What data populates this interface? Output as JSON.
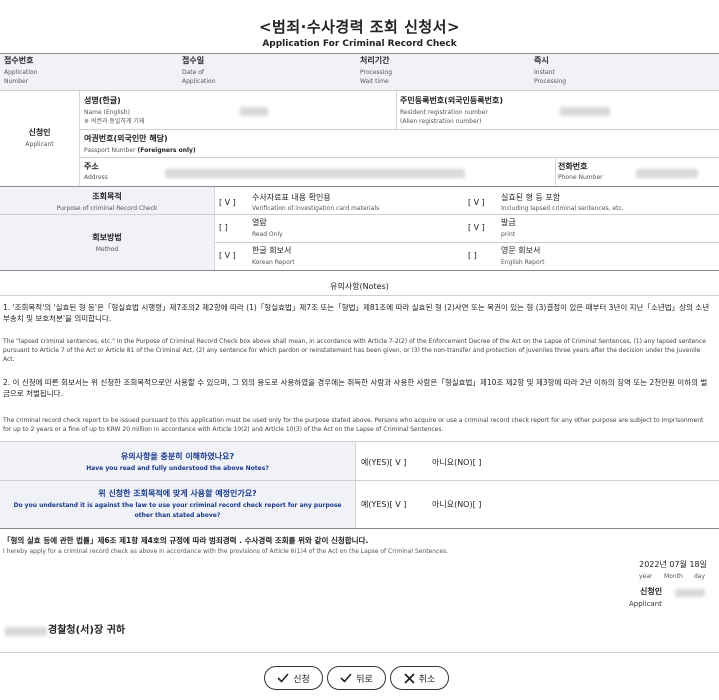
{
  "form": {
    "title": "<범죄·수사경력 조회 신청서>",
    "subtitle": "Application For Criminal Record Check"
  },
  "header_row": {
    "receipt_no_ko": "접수번호",
    "receipt_no_en1": "Application",
    "receipt_no_en2": "Number",
    "receipt_date_ko": "접수일",
    "receipt_date_en1": "Date of",
    "receipt_date_en2": "Application",
    "processing_ko": "처리기간",
    "processing_en1": "Processing",
    "processing_en2": "Wait time",
    "instant_ko": "즉시",
    "instant_en1": "Instant",
    "instant_en2": "Processing"
  },
  "applicant": {
    "label_ko": "신청인",
    "label_en": "Applicant",
    "name_ko": "성명(한글)",
    "name_en": "Name (English)",
    "name_note": "※ 여권과 동일하게 기재",
    "rrn_ko": "주민등록번호(외국인등록번호)",
    "rrn_en1": "Resident registration number",
    "rrn_en2": "(Alien registration number)",
    "passport_ko": "여권번호(외국인만 해당)",
    "passport_en": "Passport Number",
    "passport_en_bold": "(Foreigners only)",
    "address_ko": "주소",
    "address_en": "Address",
    "phone_ko": "전화번호",
    "phone_en": "Phone Number"
  },
  "purpose": {
    "label_ko": "조회목적",
    "label_en": "Purpose of criminal Record Check",
    "opt1_mark": "[ V ]",
    "opt1_ko": "수사자료표 내용 확인용",
    "opt1_en": "Verification of investigation card materials",
    "opt2_mark": "[ V ]",
    "opt2_ko": "실효된 형 등 포함",
    "opt2_en": "Including lapsed criminal sentences, etc."
  },
  "method": {
    "label_ko": "회보방법",
    "label_en": "Method",
    "opt1_mark": "[  ]",
    "opt1_ko": "열람",
    "opt1_en": "Read Only",
    "opt2_mark": "[ V ]",
    "opt2_ko": "발급",
    "opt2_en": "print",
    "opt3_mark": "[ V ]",
    "opt3_ko": "한글 회보서",
    "opt3_en": "Korean Report",
    "opt4_mark": "[  ]",
    "opt4_ko": "영문 회보서",
    "opt4_en": "English Report"
  },
  "notes": {
    "heading": "유의사항(Notes)",
    "p1_ko": "1. '조회목적'의 '실효된 형 등'은「형실효법 시행령」제7조의2 제2항에 따라 (1)「형실효법」제7조 또는「형법」제81조에 따라 실효된 형 (2)사면 또는 복권이 있는 형 (3)결정이 있은 때부터 3년이 지난「소년법」상의 소년부송치 및 보호처분'을 의미합니다.",
    "p1_en": "The \"lapsed criminal sentences, etc.\" in the Purpose of Criminal Record Check box above shall mean, in accordance with Article 7-2(2) of the Enforcement Decree of the Act on the Lapse of Criminal Sentences, (1) any lapsed sentence pursuant to Article 7 of the Act or Article 81 of the Criminal Act, (2) any sentence for which pardon or reinstatement has been given, or (3) the non-transfer and protection of juveniles three years after the decision under the Juvenile Act.",
    "p2_ko": "2. 이 신청에 따른 회보서는 위 신청한 조회목적으로만 사용할 수 있으며, 그 외의 용도로 사용하였을 경우에는 취득한 사람과 사용한 사람은「형실효법」제10조 제2항 및 제3항에 따라 2년 이하의 징역 또는 2천만원 이하의 벌금으로 처벌됩니다.",
    "p2_en": "The criminal record check report to be issued pursuant to this application must be used only for the purpose stated above. Persons who acquire or use a criminal record check report for any other purpose are subject to imprisonment for up to 2 years or a fine of up to KRW 20 million in accordance with Article 10(2) and Article 10(3) of the Act on the Lapse of Criminal Sentences."
  },
  "questions": {
    "q1_ko": "유의사항을 충분히 이해하였나요?",
    "q1_en": "Have you read and fully understood the above Notes?",
    "q1_yes": "예(YES)[ V ]",
    "q1_no": "아니요(NO)[  ]",
    "q2_ko": "위 신청한 조회목적에 맞게 사용할 예정인가요?",
    "q2_en1": "Do you understand it is against the law to use your criminal record check report for any purpose",
    "q2_en2": "other than stated above?",
    "q2_yes": "예(YES)[ V ]",
    "q2_no": "아니요(NO)[  ]"
  },
  "declaration": {
    "ko": "「형의 실효 등에 관한 법률」제6조 제1항 제4호의 규정에 따라 범죄경력 . 수사경력 조회를 위와 같이 신청합니다.",
    "en": "I hereby apply for a criminal record check as above in accordance with the provisions of Article 6(1)4 of the Act on the Lapse of Criminal Sentences.",
    "date": "2022년 07월 18일",
    "date_year": "year",
    "date_month": "Month",
    "date_day": "day",
    "signer_ko": "신청인",
    "signer_en": "Applicant",
    "addressee": "경찰청(서)장 귀하"
  },
  "buttons": {
    "apply": "신청",
    "back": "뒤로",
    "cancel": "취소"
  },
  "colors": {
    "section_shade": "#f0f2f8",
    "redacted": "#d9d9d9"
  }
}
